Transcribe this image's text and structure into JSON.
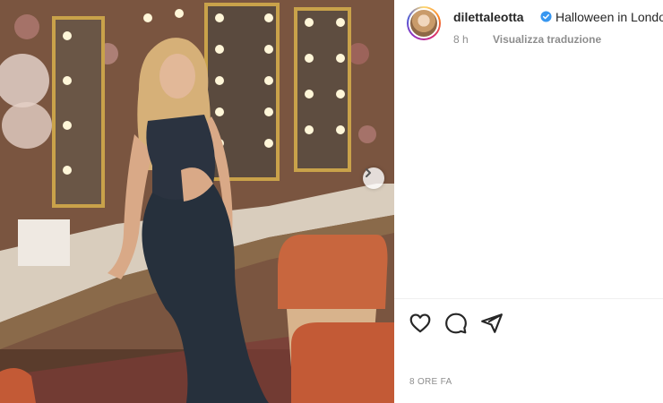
{
  "post": {
    "username": "dilettaleotta",
    "caption": "Halloween in London",
    "time_ago": "8 h",
    "translate_label": "Visualizza traduzione",
    "date_label": "8 ORE FA"
  },
  "icons": {
    "verified": "verified-badge-icon",
    "like": "heart-icon",
    "comment": "comment-icon",
    "share": "paper-plane-icon",
    "next": "chevron-right-icon"
  },
  "colors": {
    "verified_blue": "#3897f0",
    "text": "#262626",
    "muted": "#8e8e8e"
  }
}
